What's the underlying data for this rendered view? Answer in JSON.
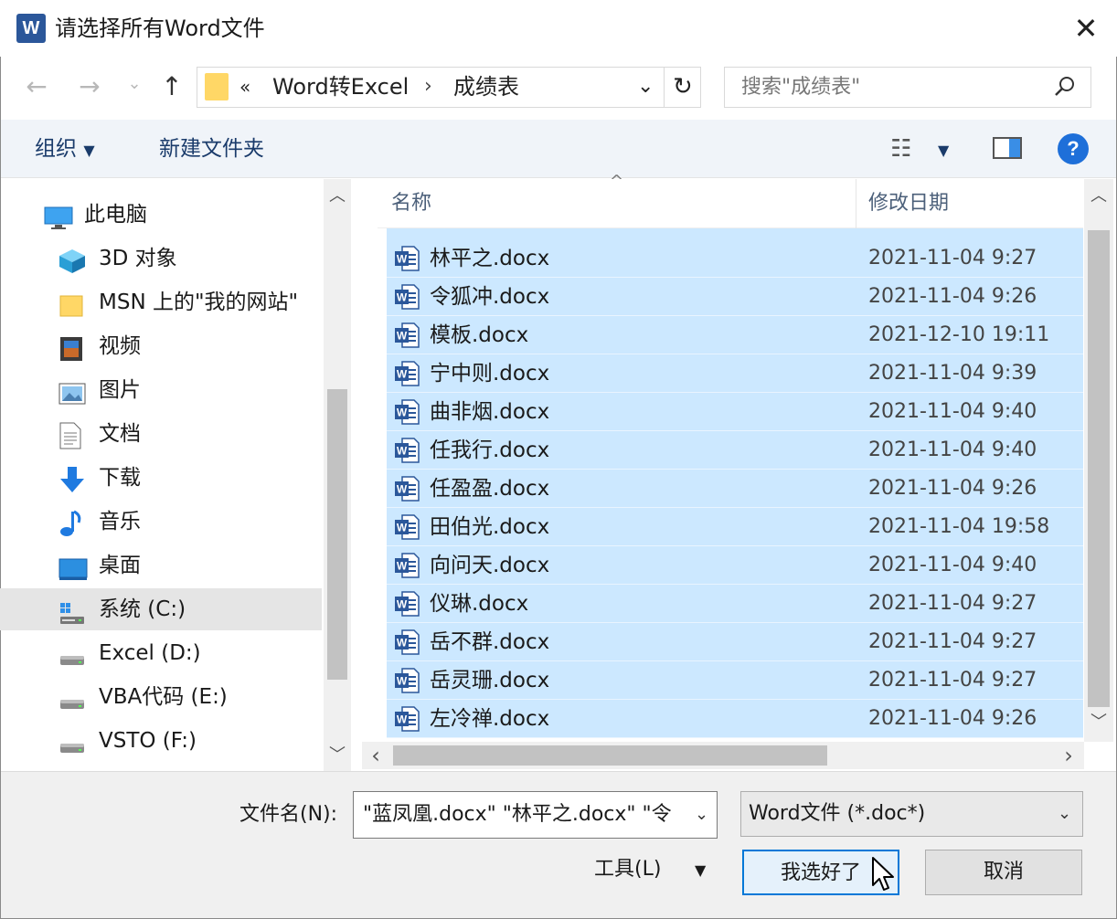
{
  "window": {
    "title": "请选择所有Word文件",
    "logo_letter": "W",
    "close_glyph": "✕"
  },
  "nav": {
    "back_glyph": "←",
    "forward_glyph": "→",
    "recent_glyph": "⌄",
    "up_glyph": "↑",
    "breadcrumb_prefix": "«",
    "breadcrumbs": [
      "Word转Excel",
      "成绩表"
    ],
    "breadcrumb_sep": "›",
    "dropdown_glyph": "⌄",
    "refresh_glyph": "↻",
    "search_placeholder": "搜索\"成绩表\"",
    "search_glyph": "⚲"
  },
  "commandbar": {
    "organize": "组织",
    "organize_caret": "▼",
    "new_folder": "新建文件夹",
    "view_glyph": "☷",
    "view_caret": "▼",
    "help": "?"
  },
  "sidebar": {
    "items": [
      {
        "label": "此电脑",
        "icon": "computer-icon"
      },
      {
        "label": "3D 对象",
        "icon": "3d-objects-icon"
      },
      {
        "label": "MSN 上的\"我的网站\"",
        "icon": "folder-icon"
      },
      {
        "label": "视频",
        "icon": "video-icon"
      },
      {
        "label": "图片",
        "icon": "pictures-icon"
      },
      {
        "label": "文档",
        "icon": "documents-icon"
      },
      {
        "label": "下载",
        "icon": "download-icon"
      },
      {
        "label": "音乐",
        "icon": "music-icon"
      },
      {
        "label": "桌面",
        "icon": "desktop-icon"
      },
      {
        "label": "系统 (C:)",
        "icon": "system-drive-icon",
        "selected": true
      },
      {
        "label": "Excel (D:)",
        "icon": "drive-icon"
      },
      {
        "label": "VBA代码 (E:)",
        "icon": "drive-icon"
      },
      {
        "label": "VSTO (F:)",
        "icon": "drive-icon"
      }
    ]
  },
  "filelist": {
    "columns": [
      "名称",
      "修改日期"
    ],
    "sort_glyph": "^",
    "rows": [
      {
        "name": "林平之.docx",
        "date": "2021-11-04 9:27"
      },
      {
        "name": "令狐冲.docx",
        "date": "2021-11-04 9:26"
      },
      {
        "name": "模板.docx",
        "date": "2021-12-10 19:11"
      },
      {
        "name": "宁中则.docx",
        "date": "2021-11-04 9:39"
      },
      {
        "name": "曲非烟.docx",
        "date": "2021-11-04 9:40"
      },
      {
        "name": "任我行.docx",
        "date": "2021-11-04 9:40"
      },
      {
        "name": "任盈盈.docx",
        "date": "2021-11-04 9:26"
      },
      {
        "name": "田伯光.docx",
        "date": "2021-11-04 19:58"
      },
      {
        "name": "向问天.docx",
        "date": "2021-11-04 9:40"
      },
      {
        "name": "仪琳.docx",
        "date": "2021-11-04 9:27"
      },
      {
        "name": "岳不群.docx",
        "date": "2021-11-04 9:27"
      },
      {
        "name": "岳灵珊.docx",
        "date": "2021-11-04 9:27"
      },
      {
        "name": "左冷禅.docx",
        "date": "2021-11-04 9:26"
      }
    ]
  },
  "scroll": {
    "up": "︿",
    "down": "﹀",
    "left": "‹",
    "right": "›"
  },
  "bottom": {
    "filename_label": "文件名(N):",
    "filename_value": "\"蓝凤凰.docx\" \"林平之.docx\" \"令",
    "filetype_value": "Word文件 (*.doc*)",
    "chevron": "⌄",
    "tools_label": "工具(L)",
    "tools_caret": "▼",
    "ok_label": "我选好了",
    "cancel_label": "取消"
  }
}
